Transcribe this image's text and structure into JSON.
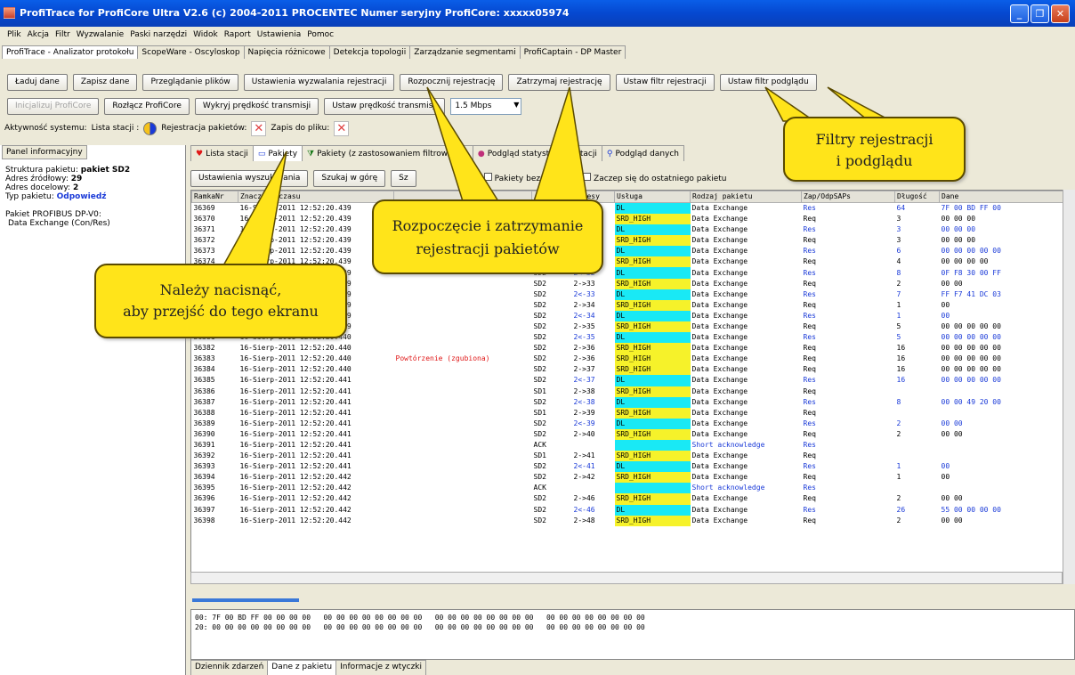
{
  "window": {
    "title": "ProfiTrace for ProfiCore Ultra V2.6 (c) 2004-2011 PROCENTEC  Numer seryjny ProfiCore: xxxxx05974"
  },
  "menu": [
    "Plik",
    "Akcja",
    "Filtr",
    "Wyzwalanie",
    "Paski narzędzi",
    "Widok",
    "Raport",
    "Ustawienia",
    "Pomoc"
  ],
  "top_tabs": [
    "ProfiTrace - Analizator protokołu",
    "ScopeWare - Oscyloskop",
    "Napięcia różnicowe",
    "Detekcja topologii",
    "Zarządzanie segmentami",
    "ProfiCaptain - DP Master"
  ],
  "toolbar1": {
    "load": "Ładuj dane",
    "save": "Zapisz dane",
    "browse": "Przeglądanie plików",
    "trigger_settings": "Ustawienia wyzwalania rejestracji",
    "start": "Rozpocznij rejestrację",
    "stop": "Zatrzymaj rejestrację",
    "record_filter": "Ustaw filtr rejestracji",
    "view_filter": "Ustaw filtr podglądu"
  },
  "toolbar2": {
    "init": "Inicjalizuj ProfiCore",
    "disconnect": "Rozłącz ProfiCore",
    "detect_speed": "Wykryj prędkość transmisji",
    "set_speed": "Ustaw prędkość transmisji",
    "speed_value": "1.5 Mbps"
  },
  "status_row": {
    "activity": "Aktywność systemu:",
    "station_list": "Lista stacji :",
    "recording": "Rejestracja pakietów:",
    "save_file": "Zapis do pliku:"
  },
  "info_panel": {
    "tab": "Panel informacyjny",
    "structure_label": "Struktura pakietu:",
    "structure_value": "pakiet SD2",
    "src_label": "Adres źródłowy:",
    "src_value": "29",
    "dst_label": "Adres docelowy:",
    "dst_value": "2",
    "type_label": "Typ pakietu:",
    "type_value": "Odpowiedź",
    "dp_title": "Pakiet PROFIBUS DP-V0:",
    "dp_value": "Data Exchange (Con/Res)"
  },
  "main_tabs": [
    "Lista stacji",
    "Pakiety",
    "Pakiety (z zastosowaniem filtrowania)",
    "Podgląd statystyk dla stacji",
    "Podgląd danych"
  ],
  "main_toolbar": {
    "search_settings": "Ustawienia wyszukiwania",
    "search_up": "Szukaj w górę",
    "search_down": "Sz",
    "chk_no_repeat": "Pakiety bez repetycji",
    "chk_start_last": "Zaczep się do ostatniego pakietu"
  },
  "table": {
    "headers": [
      "RamkaNr",
      "Znacznik czasu",
      "",
      "",
      "Adresy",
      "Usługa",
      "Rodzaj pakietu",
      "Zap/OdpSAPs",
      "Długość",
      "Dane"
    ],
    "rows": [
      [
        "36369",
        "16-Sierp-2011 12:52:20.439",
        "",
        "SD2",
        "2<-29",
        "DL",
        "Data Exchange",
        "Res",
        "64",
        "7F 00 BD FF 00"
      ],
      [
        "36370",
        "16-Sierp-2011 12:52:20.439",
        "",
        "SD2",
        "2->30",
        "SRD_HIGH",
        "Data Exchange",
        "Req",
        "3",
        "00 00 00"
      ],
      [
        "36371",
        "16-Sierp-2011 12:52:20.439",
        "",
        "SD2",
        "2<-30",
        "DL",
        "Data Exchange",
        "Res",
        "3",
        "00 00 00"
      ],
      [
        "36372",
        "16-Sierp-2011 12:52:20.439",
        "",
        "SD2",
        "2->31",
        "SRD_HIGH",
        "Data Exchange",
        "Req",
        "3",
        "00 00 00"
      ],
      [
        "36373",
        "16-Sierp-2011 12:52:20.439",
        "",
        "SD2",
        "2<-31",
        "DL",
        "Data Exchange",
        "Res",
        "6",
        "00 00 00 00 00"
      ],
      [
        "36374",
        "16-Sierp-2011 12:52:20.439",
        "",
        "SD2",
        "2->32",
        "SRD_HIGH",
        "Data Exchange",
        "Req",
        "4",
        "00 00 00 00"
      ],
      [
        "36375",
        "16-Sierp-2011 12:52:20.439",
        "",
        "SD2",
        "2<-32",
        "DL",
        "Data Exchange",
        "Res",
        "8",
        "0F F8 30 00 FF"
      ],
      [
        "36376",
        "16-Sierp-2011 12:52:20.439",
        "",
        "SD2",
        "2->33",
        "SRD_HIGH",
        "Data Exchange",
        "Req",
        "2",
        "00 00"
      ],
      [
        "36377",
        "16-Sierp-2011 12:52:20.439",
        "",
        "SD2",
        "2<-33",
        "DL",
        "Data Exchange",
        "Res",
        "7",
        "FF F7 41 DC 03"
      ],
      [
        "36378",
        "16-Sierp-2011 12:52:20.439",
        "",
        "SD2",
        "2->34",
        "SRD_HIGH",
        "Data Exchange",
        "Req",
        "1",
        "00"
      ],
      [
        "36379",
        "16-Sierp-2011 12:52:20.439",
        "",
        "SD2",
        "2<-34",
        "DL",
        "Data Exchange",
        "Res",
        "1",
        "00"
      ],
      [
        "36380",
        "16-Sierp-2011 12:52:20.439",
        "",
        "SD2",
        "2->35",
        "SRD_HIGH",
        "Data Exchange",
        "Req",
        "5",
        "00 00 00 00 00"
      ],
      [
        "36381",
        "16-Sierp-2011 12:52:20.440",
        "",
        "SD2",
        "2<-35",
        "DL",
        "Data Exchange",
        "Res",
        "5",
        "00 00 00 00 00"
      ],
      [
        "36382",
        "16-Sierp-2011 12:52:20.440",
        "",
        "SD2",
        "2->36",
        "SRD_HIGH",
        "Data Exchange",
        "Req",
        "16",
        "00 00 00 00 00"
      ],
      [
        "36383",
        "16-Sierp-2011 12:52:20.440",
        "Powtórzenie (zgubiona)",
        "SD2",
        "2->36",
        "SRD_HIGH",
        "Data Exchange",
        "Req",
        "16",
        "00 00 00 00 00"
      ],
      [
        "36384",
        "16-Sierp-2011 12:52:20.440",
        "",
        "SD2",
        "2->37",
        "SRD_HIGH",
        "Data Exchange",
        "Req",
        "16",
        "00 00 00 00 00"
      ],
      [
        "36385",
        "16-Sierp-2011 12:52:20.441",
        "",
        "SD2",
        "2<-37",
        "DL",
        "Data Exchange",
        "Res",
        "16",
        "00 00 00 00 00"
      ],
      [
        "36386",
        "16-Sierp-2011 12:52:20.441",
        "",
        "SD1",
        "2->38",
        "SRD_HIGH",
        "Data Exchange",
        "Req",
        "",
        ""
      ],
      [
        "36387",
        "16-Sierp-2011 12:52:20.441",
        "",
        "SD2",
        "2<-38",
        "DL",
        "Data Exchange",
        "Res",
        "8",
        "00 00 49 20 00"
      ],
      [
        "36388",
        "16-Sierp-2011 12:52:20.441",
        "",
        "SD1",
        "2->39",
        "SRD_HIGH",
        "Data Exchange",
        "Req",
        "",
        ""
      ],
      [
        "36389",
        "16-Sierp-2011 12:52:20.441",
        "",
        "SD2",
        "2<-39",
        "DL",
        "Data Exchange",
        "Res",
        "2",
        "00 00"
      ],
      [
        "36390",
        "16-Sierp-2011 12:52:20.441",
        "",
        "SD2",
        "2->40",
        "SRD_HIGH",
        "Data Exchange",
        "Req",
        "2",
        "00 00"
      ],
      [
        "36391",
        "16-Sierp-2011 12:52:20.441",
        "",
        "ACK",
        "",
        "",
        "Short acknowledge",
        "Res",
        "",
        ""
      ],
      [
        "36392",
        "16-Sierp-2011 12:52:20.441",
        "",
        "SD1",
        "2->41",
        "SRD_HIGH",
        "Data Exchange",
        "Req",
        "",
        ""
      ],
      [
        "36393",
        "16-Sierp-2011 12:52:20.441",
        "",
        "SD2",
        "2<-41",
        "DL",
        "Data Exchange",
        "Res",
        "1",
        "00"
      ],
      [
        "36394",
        "16-Sierp-2011 12:52:20.442",
        "",
        "SD2",
        "2->42",
        "SRD_HIGH",
        "Data Exchange",
        "Req",
        "1",
        "00"
      ],
      [
        "36395",
        "16-Sierp-2011 12:52:20.442",
        "",
        "ACK",
        "",
        "",
        "Short acknowledge",
        "Res",
        "",
        ""
      ],
      [
        "36396",
        "16-Sierp-2011 12:52:20.442",
        "",
        "SD2",
        "2->46",
        "SRD_HIGH",
        "Data Exchange",
        "Req",
        "2",
        "00 00"
      ],
      [
        "36397",
        "16-Sierp-2011 12:52:20.442",
        "",
        "SD2",
        "2<-46",
        "DL",
        "Data Exchange",
        "Res",
        "26",
        "55 00 00 00 00"
      ],
      [
        "36398",
        "16-Sierp-2011 12:52:20.442",
        "",
        "SD2",
        "2->48",
        "SRD_HIGH",
        "Data Exchange",
        "Req",
        "2",
        "00 00"
      ]
    ]
  },
  "hex_panel": [
    "00: 7F 00 BD FF 00 00 00 00   00 00 00 00 00 00 00 00   00 00 00 00 00 00 00 00   00 00 00 00 00 00 00 00",
    "20: 00 00 00 00 00 00 00 00   00 00 00 00 00 00 00 00   00 00 00 00 00 00 00 00   00 00 00 00 00 00 00 00"
  ],
  "bottom_tabs": [
    "Dziennik zdarzeń",
    "Dane z pakietu",
    "Informacje z wtyczki"
  ],
  "callouts": {
    "filters": [
      "Filtry rejestracji",
      "i podglądu"
    ],
    "start_stop": [
      "Rozpoczęcie i zatrzymanie",
      "rejestracji pakietów"
    ],
    "press": [
      "Należy nacisnąć,",
      "aby przejść do tego ekranu"
    ]
  },
  "colors": {
    "title_bar": "#0548d0",
    "dl_highlight": "#19e9f5",
    "srd_highlight": "#f6f22a",
    "callout": "#ffe41a",
    "response_text": "#1a3ad8",
    "repeat_text": "#e01818"
  }
}
